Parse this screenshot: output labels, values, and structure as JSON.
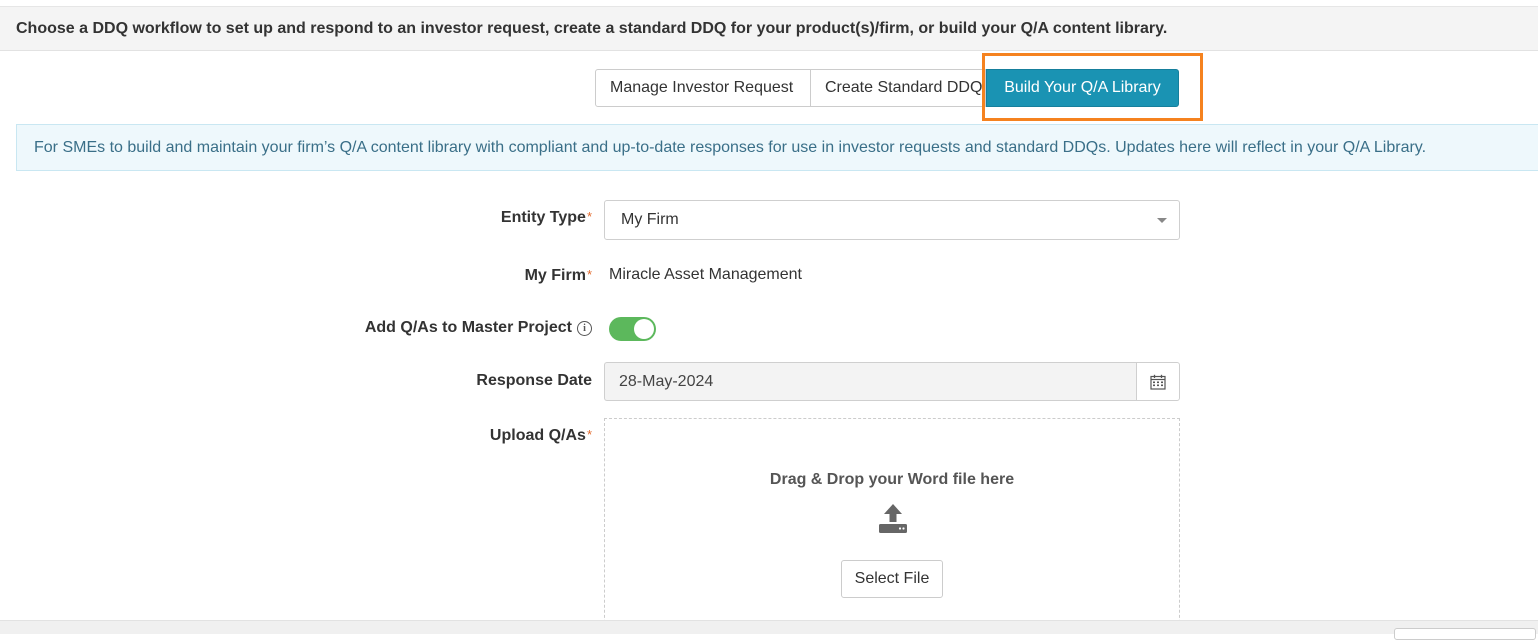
{
  "header": {
    "instruction": "Choose a DDQ workflow to set up and respond to an investor request, create a standard DDQ for your product(s)/firm, or build your Q/A content library."
  },
  "workflow_tabs": [
    {
      "label": "Manage Investor Request",
      "active": false
    },
    {
      "label": "Create Standard DDQ",
      "active": false
    },
    {
      "label": "Build Your Q/A Library",
      "active": true
    }
  ],
  "info_banner": {
    "text": "For SMEs to build and maintain your firm’s Q/A content library with compliant and up-to-date responses for use in investor requests and standard DDQs. Updates here will reflect in your Q/A Library."
  },
  "form": {
    "required_marker": "*",
    "entity_type": {
      "label": "Entity Type",
      "value": "My Firm"
    },
    "my_firm": {
      "label": "My Firm",
      "value": "Miracle Asset Management"
    },
    "add_to_master": {
      "label": "Add Q/As to Master Project",
      "info_glyph": "i",
      "enabled": true
    },
    "response_date": {
      "label": "Response Date",
      "value": "28-May-2024"
    },
    "upload": {
      "label": "Upload Q/As",
      "drop_text": "Drag & Drop your Word file here",
      "button_label": "Select File"
    }
  },
  "colors": {
    "accent": "#1a93b3",
    "highlight": "#f5821f",
    "toggle_on": "#5cb85c",
    "required": "#e2692c"
  },
  "icons": [
    "info-icon",
    "calendar-icon",
    "upload-icon",
    "dropdown-caret-icon"
  ]
}
